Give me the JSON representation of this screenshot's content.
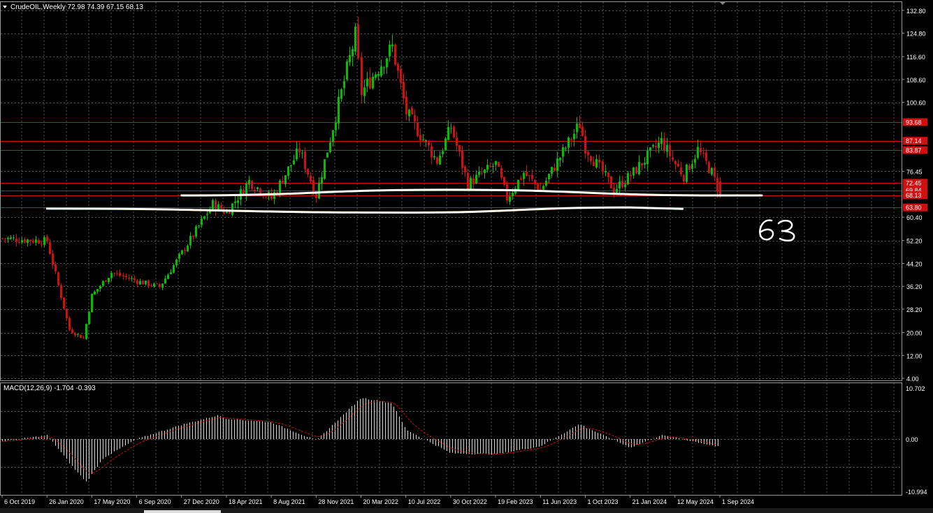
{
  "window": {
    "title": "CrudeOIL,Weekly  72.98 74.39 67.15 68.13",
    "macd_title": "MACD(12,26,9) -1.704 -0.393",
    "annotation": "63"
  },
  "colors": {
    "background": "#000000",
    "grid": "#5a5a5a",
    "bull": "#00c000",
    "bear": "#d01010",
    "level_line": "#c81414",
    "trend_line": "#ffffff",
    "text": "#ffffff",
    "macd_hist": "#d8d8d8",
    "macd_signal": "#d01010"
  },
  "chart_data": [
    {
      "type": "candlestick",
      "timeframe": "Weekly",
      "ylim": [
        4.0,
        133.0
      ],
      "y_ticks": [
        "132.80",
        "124.80",
        "116.60",
        "108.60",
        "100.60",
        "76.45",
        "60.40",
        "52.20",
        "44.20",
        "36.20",
        "28.20",
        "20.00",
        "12.00",
        "4.00"
      ],
      "x_labels": [
        "6 Oct 2019",
        "26 Jan 2020",
        "17 May 2020",
        "6 Sep 2020",
        "27 Dec 2020",
        "18 Apr 2021",
        "8 Aug 2021",
        "28 Nov 2021",
        "20 Mar 2022",
        "10 Jul 2022",
        "30 Oct 2022",
        "19 Feb 2023",
        "11 Jun 2023",
        "1 Oct 2023",
        "21 Jan 2024",
        "12 May 2024",
        "1 Sep 2024"
      ],
      "last_bar": {
        "open": 72.98,
        "high": 74.39,
        "low": 67.15,
        "close": 68.13
      },
      "close_path": [
        {
          "x": "6 Oct 2019",
          "y": 53
        },
        {
          "x": "26 Jan 2020",
          "y": 52
        },
        {
          "x": "22 Mar 2020",
          "y": 21
        },
        {
          "x": "26 Apr 2020",
          "y": 18
        },
        {
          "x": "17 May 2020",
          "y": 33
        },
        {
          "x": "5 Jul 2020",
          "y": 41
        },
        {
          "x": "6 Sep 2020",
          "y": 38
        },
        {
          "x": "1 Nov 2020",
          "y": 36
        },
        {
          "x": "27 Dec 2020",
          "y": 48
        },
        {
          "x": "14 Mar 2021",
          "y": 65
        },
        {
          "x": "18 Apr 2021",
          "y": 62
        },
        {
          "x": "13 Jun 2021",
          "y": 73
        },
        {
          "x": "8 Aug 2021",
          "y": 67
        },
        {
          "x": "17 Oct 2021",
          "y": 84
        },
        {
          "x": "28 Nov 2021",
          "y": 68
        },
        {
          "x": "6 Mar 2022",
          "y": 124
        },
        {
          "x": "20 Mar 2022",
          "y": 104
        },
        {
          "x": "5 Jun 2022",
          "y": 120
        },
        {
          "x": "10 Jul 2022",
          "y": 97
        },
        {
          "x": "25 Sep 2022",
          "y": 80
        },
        {
          "x": "30 Oct 2022",
          "y": 92
        },
        {
          "x": "11 Dec 2022",
          "y": 72
        },
        {
          "x": "19 Feb 2023",
          "y": 79
        },
        {
          "x": "19 Mar 2023",
          "y": 67
        },
        {
          "x": "30 Apr 2023",
          "y": 76
        },
        {
          "x": "11 Jun 2023",
          "y": 70
        },
        {
          "x": "17 Sep 2023",
          "y": 93
        },
        {
          "x": "1 Oct 2023",
          "y": 85
        },
        {
          "x": "10 Dec 2023",
          "y": 70
        },
        {
          "x": "21 Jan 2024",
          "y": 75
        },
        {
          "x": "7 Apr 2024",
          "y": 87
        },
        {
          "x": "12 May 2024",
          "y": 79
        },
        {
          "x": "2 Jun 2024",
          "y": 75
        },
        {
          "x": "7 Jul 2024",
          "y": 84
        },
        {
          "x": "11 Aug 2024",
          "y": 76
        },
        {
          "x": "1 Sep 2024",
          "y": 68.13
        }
      ],
      "horizontal_levels": [
        {
          "label": "93.68",
          "value": 93.68
        },
        {
          "label": "87.14",
          "value": 87.14
        },
        {
          "label": "83.87",
          "value": 83.87
        },
        {
          "label": "72.45",
          "value": 72.45
        },
        {
          "label": "69.84",
          "value": 69.84
        },
        {
          "label": "68.13",
          "value": 68.13
        },
        {
          "label": "63.80",
          "value": 63.8
        }
      ],
      "level_labels_on_axis": [
        "93.68",
        "87.14",
        "83.87",
        "72.45",
        "69.84",
        "68.13",
        "63.80"
      ],
      "drawn_lines": [
        {
          "name": "upper-support",
          "points": [
            {
              "x": "27 Dec 2020",
              "y": 68
            },
            {
              "x": "30 Oct 2022",
              "y": 70
            },
            {
              "x": "1 Sep 2024",
              "y": 68
            }
          ]
        },
        {
          "name": "lower-support",
          "points": [
            {
              "x": "26 Jan 2020",
              "y": 63.4
            },
            {
              "x": "10 Jul 2022",
              "y": 62
            },
            {
              "x": "21 Jan 2024",
              "y": 63.8
            }
          ]
        }
      ]
    },
    {
      "type": "bar",
      "indicator": "MACD(12,26,9)",
      "main": -1.704,
      "signal": -0.393,
      "ylim": [
        -10.994,
        10.702
      ],
      "y_ticks": [
        "10.702",
        "0.00",
        "-10.994"
      ],
      "histogram_path": [
        {
          "x": "6 Oct 2019",
          "y": -0.5
        },
        {
          "x": "26 Jan 2020",
          "y": 0.8
        },
        {
          "x": "5 Apr 2020",
          "y": -6.5
        },
        {
          "x": "3 May 2020",
          "y": -9.0
        },
        {
          "x": "14 Jun 2020",
          "y": -4.0
        },
        {
          "x": "6 Sep 2020",
          "y": 0.0
        },
        {
          "x": "27 Dec 2020",
          "y": 3.0
        },
        {
          "x": "28 Mar 2021",
          "y": 5.0
        },
        {
          "x": "18 Apr 2021",
          "y": 4.3
        },
        {
          "x": "8 Aug 2021",
          "y": 3.5
        },
        {
          "x": "28 Nov 2021",
          "y": -0.3
        },
        {
          "x": "20 Mar 2022",
          "y": 8.7
        },
        {
          "x": "5 Jun 2022",
          "y": 7.5
        },
        {
          "x": "10 Jul 2022",
          "y": 2.0
        },
        {
          "x": "30 Oct 2022",
          "y": -3.0
        },
        {
          "x": "19 Feb 2023",
          "y": -3.2
        },
        {
          "x": "11 Jun 2023",
          "y": -1.5
        },
        {
          "x": "17 Sep 2023",
          "y": 3.2
        },
        {
          "x": "1 Oct 2023",
          "y": 2.5
        },
        {
          "x": "21 Jan 2024",
          "y": -1.8
        },
        {
          "x": "7 Apr 2024",
          "y": 0.8
        },
        {
          "x": "12 May 2024",
          "y": 0.3
        },
        {
          "x": "1 Sep 2024",
          "y": -1.7
        }
      ]
    }
  ]
}
